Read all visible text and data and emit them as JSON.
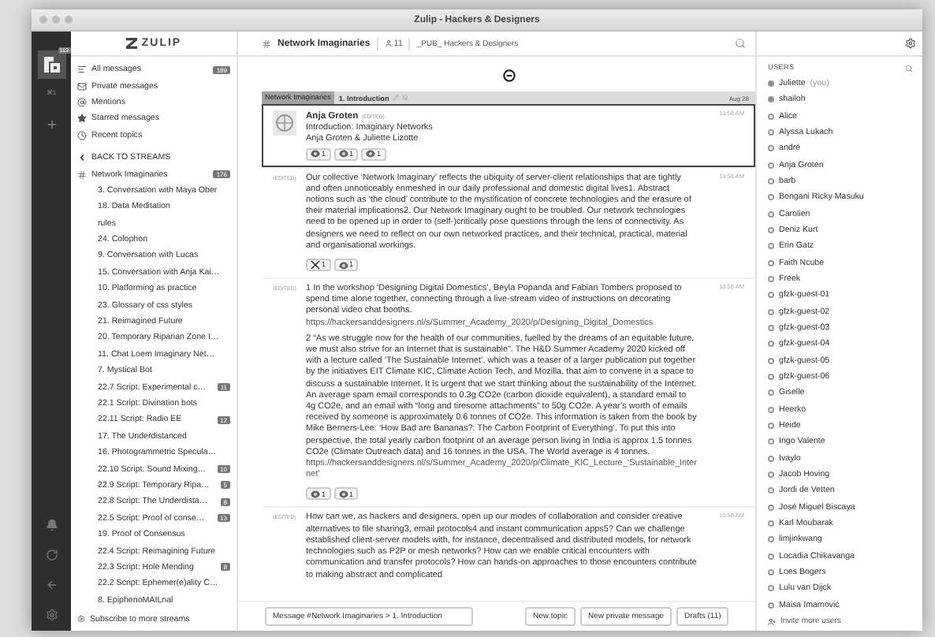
{
  "window": {
    "title": "Zulip - Hackers & Designers"
  },
  "rail": {
    "org_unread": "189",
    "shortcut": "⌘1"
  },
  "logo": "ZULIP",
  "nav": [
    {
      "kind": "all",
      "label": "All messages",
      "count": "189"
    },
    {
      "kind": "private",
      "label": "Private messages"
    },
    {
      "kind": "mentions",
      "label": "Mentions"
    },
    {
      "kind": "starred",
      "label": "Starred messages"
    },
    {
      "kind": "recent",
      "label": "Recent topics"
    }
  ],
  "back": "BACK TO STREAMS",
  "stream": {
    "name": "Network Imaginaries",
    "count": "176",
    "topics": [
      {
        "name": "3. Conversation with Maya Ober"
      },
      {
        "name": "18. Data Meditation"
      },
      {
        "name": "rules"
      },
      {
        "name": "24. Colophon"
      },
      {
        "name": "9. Conversation with Lucas"
      },
      {
        "name": "15. Conversation with Anja Kai…"
      },
      {
        "name": "10. Platforming as practice"
      },
      {
        "name": "23. Glossary of css styles"
      },
      {
        "name": "21. Reimagined Future"
      },
      {
        "name": "20. Temporary Riparian Zone I…"
      },
      {
        "name": "11. Chat Loem Imaginary Net…"
      },
      {
        "name": "7. Mystical Bot"
      },
      {
        "name": "22.7 Script: Experimental c…",
        "count": "11"
      },
      {
        "name": "22.1 Script: Divination bots"
      },
      {
        "name": "22.11 Script: Radio EE",
        "count": "12"
      },
      {
        "name": "17. The Underdistanced"
      },
      {
        "name": "16. Photogrammetric Specula…"
      },
      {
        "name": "22.10 Script: Sound Mixing…",
        "count": "10"
      },
      {
        "name": "22.9 Script: Temporary Ripa…",
        "count": "5"
      },
      {
        "name": "22.8 Script: The Underdista…",
        "count": "8"
      },
      {
        "name": "22.5 Script: Proof of conse…",
        "count": "13"
      },
      {
        "name": "19. Proof of Consensus"
      },
      {
        "name": "22.4 Script: Reimagining Future"
      },
      {
        "name": "22.3 Script: Hole Mending",
        "count": "8"
      },
      {
        "name": "22.2 Script: Ephemer(e)ality C…"
      },
      {
        "name": "8. EpiphenoMAILnal"
      }
    ]
  },
  "subscribe": "Subscribe to more streams",
  "header": {
    "stream": "Network Imaginaries",
    "members": "11",
    "description": "_PUB_ Hackers & Designers"
  },
  "recipient_bar": {
    "stream": "Network Imaginaries",
    "topic": "1. Introduction",
    "date": "Aug 28"
  },
  "messages": [
    {
      "selected": true,
      "sender": "Anja Groten",
      "edited": "(EDITED)",
      "time": "10:58 AM",
      "paragraphs": [
        {
          "text": "Introduction: Imaginary Networks"
        },
        {
          "text": "Anja Groten & Juliette Lizotte"
        }
      ],
      "reactions": [
        {
          "kind": "emoji",
          "count": "1"
        },
        {
          "kind": "emoji",
          "count": "1"
        },
        {
          "kind": "emoji",
          "count": "1"
        }
      ]
    },
    {
      "selected": false,
      "edited": "(EDITED)",
      "time": "10:58 AM",
      "paragraphs": [
        {
          "text": "Our collective ‘Network Imaginary’ reflects the ubiquity of server-client relationships that are tightly and often unnoticeably enmeshed in our daily professional and domestic digital lives1. Abstract notions such as ‘the cloud’ contribute to the mystification of concrete technologies and the erasure of their material implications2. Our Network Imaginary ought to be troubled. Our network technologies need to be opened up in order to (self-)critically pose questions through the lens of connectivity. As designers we need to reflect on our own networked practices, and their technical, practical, material and organisational workings."
        }
      ],
      "reactions": [
        {
          "kind": "cross",
          "count": "1"
        },
        {
          "kind": "emoji",
          "count": "1"
        }
      ]
    },
    {
      "selected": false,
      "edited": "(EDITED)",
      "time": "10:58 AM",
      "paragraphs": [
        {
          "text": "1 In the workshop ‘Designing Digital Domestics’, Beyla Popanda and Fabian Tombers proposed to spend time alone together, connecting through a live-stream video of instructions on decorating personal video chat booths.",
          "link": "https://hackersanddesigners.nl/s/Summer_Academy_2020/p/Designing_Digital_Domestics"
        },
        {
          "text": "2 “As we struggle now for the health of our communities, fuelled by the dreams of an equitable future, we must also strive for an Internet that is sustainable”. The H&D Summer Academy 2020 kicked off with a lecture called ‘The Sustainable Internet’, which was a teaser of a larger publication put together by the initiatives EIT Climate KIC, Climate Action Tech, and Mozilla, that aim to convene in a space to discuss a sustainable Internet. It is urgent that we start thinking about the sustainability of the Internet. An average spam email corresponds to 0.3g CO2e (carbon dioxide equivalent), a standard email to 4g CO2e, and an email with “long and tiresome attachments” to 50g CO2e. A year’s worth of emails received by someone is approximately 0.6 tonnes of CO2e. This information is taken from the book by Mike Berners-Lee: ‘How Bad are Bananas?: The Carbon Footprint of Everything’. To put this into perspective, the total yearly carbon footprint of an average person living in India is approx 1.5 tonnes CO2e (Climate Outreach data) and 16 tonnes in the USA. The World average is 4 tonnes.",
          "link": "https://hackersanddesigners.nl/s/Summer_Academy_2020/p/Climate_KIC_Lecture_‘Sustainable_Internet’"
        }
      ],
      "reactions": [
        {
          "kind": "emoji",
          "count": "1"
        },
        {
          "kind": "emoji",
          "count": "1"
        }
      ]
    },
    {
      "selected": false,
      "edited": "(EDITED)",
      "time": "10:58 AM",
      "paragraphs": [
        {
          "text": "How can we, as hackers and designers, open up our modes of collaboration and consider creative alternatives to file sharing3, email protocols4 and instant communication apps5? Can we challenge established client-server models with, for instance, decentralised and distributed models, for network technologies such as P2P or mesh networks? How can we enable critical encounters with communication and transfer protocols? How can hands-on approaches to those encounters contribute to making abstract and complicated"
        }
      ]
    }
  ],
  "compose": {
    "message": "Message #Network Imaginaries > 1. Introduction",
    "new_topic": "New topic",
    "new_private": "New private message",
    "drafts": "Drafts (11)"
  },
  "users": {
    "heading": "USERS",
    "list": [
      {
        "name": "Juliette",
        "note": "(you)",
        "active": true
      },
      {
        "name": "shailoh",
        "active": true
      },
      {
        "name": "Alice",
        "active": false
      },
      {
        "name": "Alyssa Lukach",
        "active": false
      },
      {
        "name": "andré",
        "active": false
      },
      {
        "name": "Anja Groten",
        "active": false
      },
      {
        "name": "barb",
        "active": false
      },
      {
        "name": "Bongani Ricky Masuku",
        "active": false
      },
      {
        "name": "Carolien",
        "active": false
      },
      {
        "name": "Deniz Kurt",
        "active": false
      },
      {
        "name": "Erin Gatz",
        "active": false
      },
      {
        "name": "Faith Ncube",
        "active": false
      },
      {
        "name": "Freek",
        "active": false
      },
      {
        "name": "gfzk-guest-01",
        "active": false
      },
      {
        "name": "gfzk-guest-02",
        "active": false
      },
      {
        "name": "gfzk-guest-03",
        "active": false
      },
      {
        "name": "gfzk-guest-04",
        "active": false
      },
      {
        "name": "gfzk-guest-05",
        "active": false
      },
      {
        "name": "gfzk-guest-06",
        "active": false
      },
      {
        "name": "Giselle",
        "active": false
      },
      {
        "name": "Heerko",
        "active": false
      },
      {
        "name": "Heide",
        "active": false
      },
      {
        "name": "Ingo Valente",
        "active": false
      },
      {
        "name": "Ivaylo",
        "active": false
      },
      {
        "name": "Jacob Hoving",
        "active": false
      },
      {
        "name": "Jordi de Vetten",
        "active": false
      },
      {
        "name": "José Miguel Biscaya",
        "active": false
      },
      {
        "name": "Karl Moubarak",
        "active": false
      },
      {
        "name": "limjinkwang",
        "active": false
      },
      {
        "name": "Locadia Chikavanga",
        "active": false
      },
      {
        "name": "Loes Bogers",
        "active": false
      },
      {
        "name": "Lulu van Dijck",
        "active": false
      },
      {
        "name": "Maisa Imamović",
        "active": false
      }
    ],
    "invite": "Invite more users"
  }
}
